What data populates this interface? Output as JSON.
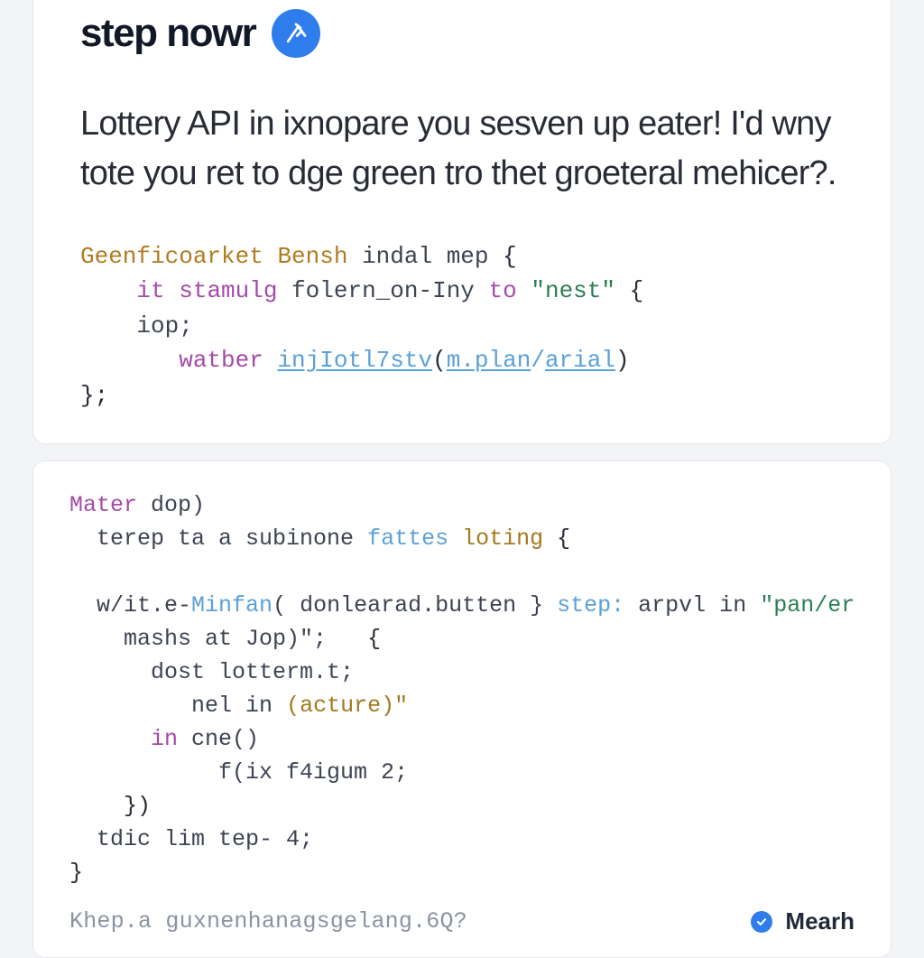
{
  "header": {
    "title": "step nowr"
  },
  "subhead": "Lottery API in ixnopare you sesven up eater! I'd wny tote you ret to dge green tro thet groeteral mehicer?.",
  "code1": {
    "l1a": "Geenficoarket",
    "l1b": "Bensh",
    "l1c": "indal mep",
    "l1d": "{",
    "l2a": "it",
    "l2b": "stamulg",
    "l2c": "folern_on-Iny",
    "l2d": "to",
    "l2e": "\"nest\"",
    "l2f": "{",
    "l3a": "iop;",
    "l4a": "watber",
    "l4b": "injIotl7stv",
    "l4c": "(",
    "l4d": "m",
    "l4e": ".",
    "l4f": "plan",
    "l4g": "/",
    "l4h": "arial",
    "l4i": ")",
    "l5a": "};"
  },
  "code2": {
    "l1a": "Mater",
    "l1b": "dop)",
    "l2a": "terep ta a subinone",
    "l2b": "fattes",
    "l2c": "loting",
    "l2d": "{",
    "l3a": "w/it.e-",
    "l3b": "Minfan",
    "l3c": "( donlearad.butten }",
    "l3d": "step:",
    "l3e": "arpvl in",
    "l3f": "\"pan/er.lin\"",
    "l3g": "\";",
    "l4a": "mashs at Jop)\";",
    "l4b": "{",
    "l5a": "dost lotterm.t;",
    "l6a": "nel in",
    "l6b": "(acture)\"",
    "l7a": "in",
    "l7b": "cne()",
    "l8a": "f(ix f4igum 2;",
    "l9a": "})",
    "l10a": "tdic lim tep- 4;",
    "l11a": "}"
  },
  "footer": {
    "left": "Khep.a guxnenhanagsgelang.6Q?",
    "right_label": "Mearh"
  }
}
